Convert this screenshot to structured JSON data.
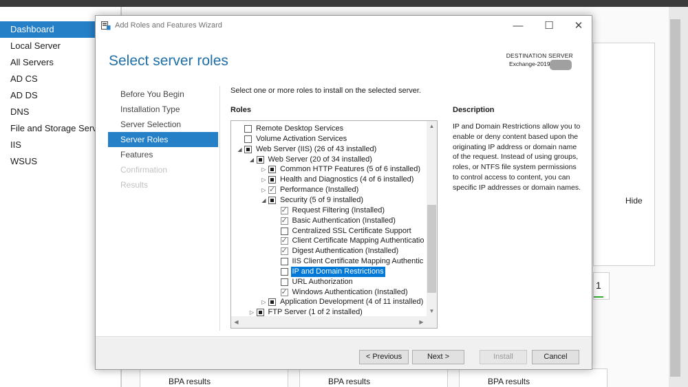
{
  "server_manager": {
    "nav": [
      {
        "label": "Dashboard",
        "selected": true
      },
      {
        "label": "Local Server"
      },
      {
        "label": "All Servers"
      },
      {
        "label": "AD CS"
      },
      {
        "label": "AD DS"
      },
      {
        "label": "DNS"
      },
      {
        "label": "File and Storage Servi"
      },
      {
        "label": "IIS"
      },
      {
        "label": "WSUS"
      }
    ],
    "hide_label": "Hide",
    "tile_count": "1",
    "bpa_results": [
      "BPA results",
      "BPA results",
      "BPA results"
    ]
  },
  "wizard": {
    "window_title": "Add Roles and Features Wizard",
    "window_buttons": {
      "minimize": "—",
      "maximize": "☐",
      "close": "✕"
    },
    "page_title": "Select server roles",
    "destination_label": "DESTINATION SERVER",
    "destination_value": "Exchange-2019",
    "steps": [
      {
        "label": "Before You Begin",
        "state": "normal"
      },
      {
        "label": "Installation Type",
        "state": "normal"
      },
      {
        "label": "Server Selection",
        "state": "normal"
      },
      {
        "label": "Server Roles",
        "state": "active"
      },
      {
        "label": "Features",
        "state": "normal"
      },
      {
        "label": "Confirmation",
        "state": "disabled"
      },
      {
        "label": "Results",
        "state": "disabled"
      }
    ],
    "instruction": "Select one or more roles to install on the selected server.",
    "roles_heading": "Roles",
    "roles": [
      {
        "label": "Remote Desktop Services",
        "level": 0,
        "state": "unchecked",
        "expander": ""
      },
      {
        "label": "Volume Activation Services",
        "level": 0,
        "state": "unchecked",
        "expander": ""
      },
      {
        "label": "Web Server (IIS) (26 of 43 installed)",
        "level": 0,
        "state": "indeterminate",
        "expander": "expanded"
      },
      {
        "label": "Web Server (20 of 34 installed)",
        "level": 1,
        "state": "indeterminate",
        "expander": "expanded"
      },
      {
        "label": "Common HTTP Features (5 of 6 installed)",
        "level": 2,
        "state": "indeterminate",
        "expander": "collapsed"
      },
      {
        "label": "Health and Diagnostics (4 of 6 installed)",
        "level": 2,
        "state": "indeterminate",
        "expander": "collapsed"
      },
      {
        "label": "Performance (Installed)",
        "level": 2,
        "state": "checked",
        "expander": "collapsed"
      },
      {
        "label": "Security (5 of 9 installed)",
        "level": 2,
        "state": "indeterminate",
        "expander": "expanded"
      },
      {
        "label": "Request Filtering (Installed)",
        "level": 3,
        "state": "checked",
        "expander": ""
      },
      {
        "label": "Basic Authentication (Installed)",
        "level": 3,
        "state": "checked",
        "expander": ""
      },
      {
        "label": "Centralized SSL Certificate Support",
        "level": 3,
        "state": "unchecked",
        "expander": ""
      },
      {
        "label": "Client Certificate Mapping Authenticatio",
        "level": 3,
        "state": "checked",
        "expander": ""
      },
      {
        "label": "Digest Authentication (Installed)",
        "level": 3,
        "state": "checked",
        "expander": ""
      },
      {
        "label": "IIS Client Certificate Mapping Authentic",
        "level": 3,
        "state": "unchecked",
        "expander": ""
      },
      {
        "label": "IP and Domain Restrictions",
        "level": 3,
        "state": "unchecked",
        "expander": "",
        "selected": true
      },
      {
        "label": "URL Authorization",
        "level": 3,
        "state": "unchecked",
        "expander": ""
      },
      {
        "label": "Windows Authentication (Installed)",
        "level": 3,
        "state": "checked",
        "expander": ""
      },
      {
        "label": "Application Development (4 of 11 installed)",
        "level": 2,
        "state": "indeterminate",
        "expander": "collapsed"
      },
      {
        "label": "FTP Server (1 of 2 installed)",
        "level": 1,
        "state": "indeterminate",
        "expander": "collapsed"
      }
    ],
    "description_heading": "Description",
    "description_text": "IP and Domain Restrictions allow you to enable or deny content based upon the originating IP address or domain name of the request. Instead of using groups, roles, or NTFS file system permissions to control access to content, you can specific IP addresses or domain names.",
    "buttons": {
      "previous": "< Previous",
      "next": "Next >",
      "install": "Install",
      "cancel": "Cancel"
    }
  },
  "colors": {
    "accent": "#2680c8",
    "title_blue": "#1e6fa8",
    "selection": "#0078d7"
  }
}
